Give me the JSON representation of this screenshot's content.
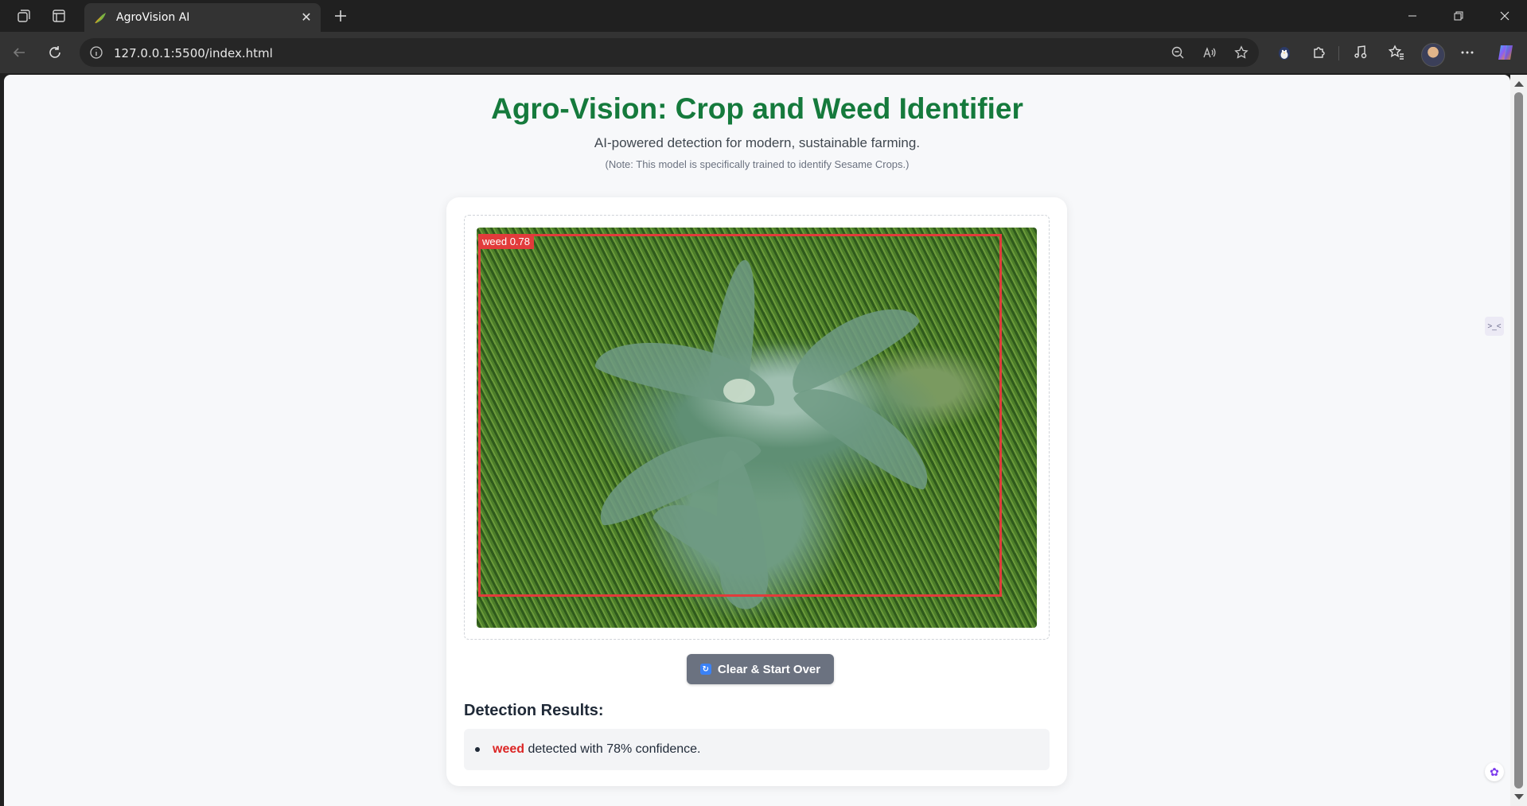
{
  "browser": {
    "tab_title": "AgroVision AI",
    "url": "127.0.0.1:5500/index.html",
    "icons": [
      "workspaces-icon",
      "tab-actions-icon",
      "leaf-favicon-icon",
      "close-icon",
      "new-tab-icon",
      "minimize-icon",
      "restore-icon",
      "close-window-icon",
      "back-icon",
      "refresh-icon",
      "info-icon",
      "zoom-out-icon",
      "read-aloud-icon",
      "favorite-star-icon",
      "extension-puzzle-icon",
      "media-icon",
      "favorites-icon",
      "more-icon",
      "copilot-icon"
    ]
  },
  "page": {
    "title": "Agro-Vision: Crop and Weed Identifier",
    "subtitle": "AI-powered detection for modern, sustainable farming.",
    "note": "(Note: This model is specifically trained to identify Sesame Crops.)"
  },
  "detection": {
    "box_label": "weed 0.78",
    "box_color": "#e23b3b"
  },
  "actions": {
    "clear_label": "Clear & Start Over"
  },
  "results": {
    "heading": "Detection Results:",
    "items": [
      {
        "class": "weed",
        "text": "detected with 78% confidence."
      }
    ]
  },
  "colors": {
    "title_green": "#157a3c",
    "weed_red": "#dc2626",
    "button_gray": "#6b7280"
  }
}
